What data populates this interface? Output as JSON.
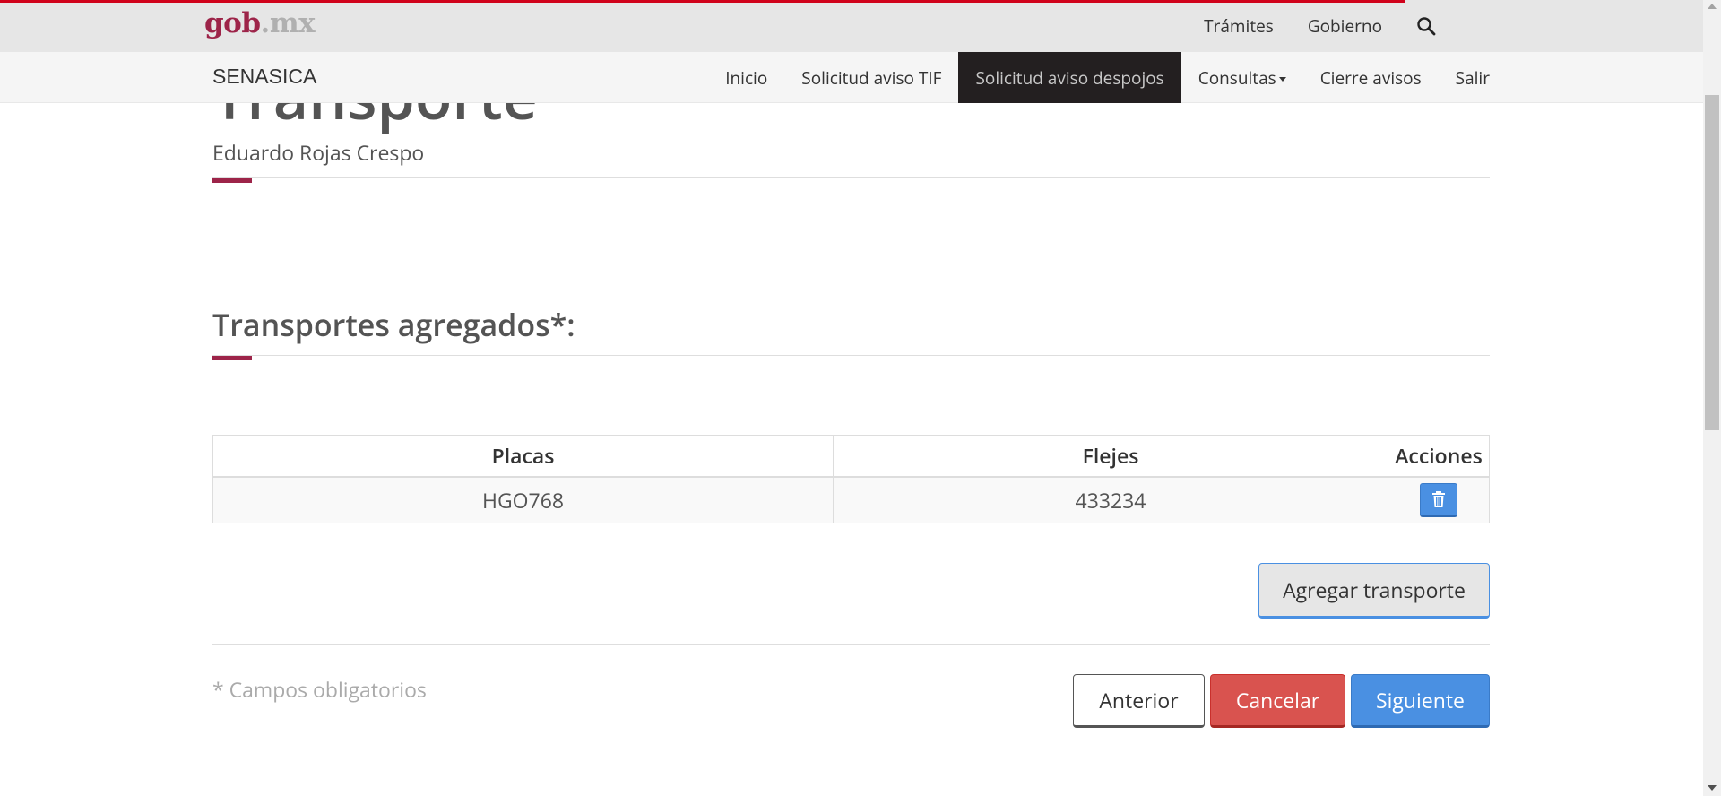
{
  "header": {
    "logo_gob": "gob",
    "logo_mx": ".mx",
    "links": [
      "Trámites",
      "Gobierno"
    ]
  },
  "nav": {
    "brand": "SENASICA",
    "items": [
      {
        "label": "Inicio"
      },
      {
        "label": "Solicitud aviso TIF"
      },
      {
        "label": "Solicitud aviso despojos"
      },
      {
        "label": "Consultas"
      },
      {
        "label": "Cierre avisos"
      },
      {
        "label": "Salir"
      }
    ]
  },
  "page": {
    "title": "Transporte",
    "subtitle": "Eduardo Rojas Crespo",
    "section_title": "Transportes agregados*:"
  },
  "table": {
    "headers": [
      "Placas",
      "Flejes",
      "Acciones"
    ],
    "rows": [
      {
        "placas": "HGO768",
        "flejes": "433234"
      }
    ]
  },
  "buttons": {
    "add": "Agregar transporte",
    "prev": "Anterior",
    "cancel": "Cancelar",
    "next": "Siguiente"
  },
  "required_note": "* Campos obligatorios",
  "colors": {
    "brand": "#9d2449",
    "active_nav": "#231f20",
    "primary": "#4a90e2",
    "danger": "#d9534f",
    "loading_bar": "#d0021b"
  }
}
